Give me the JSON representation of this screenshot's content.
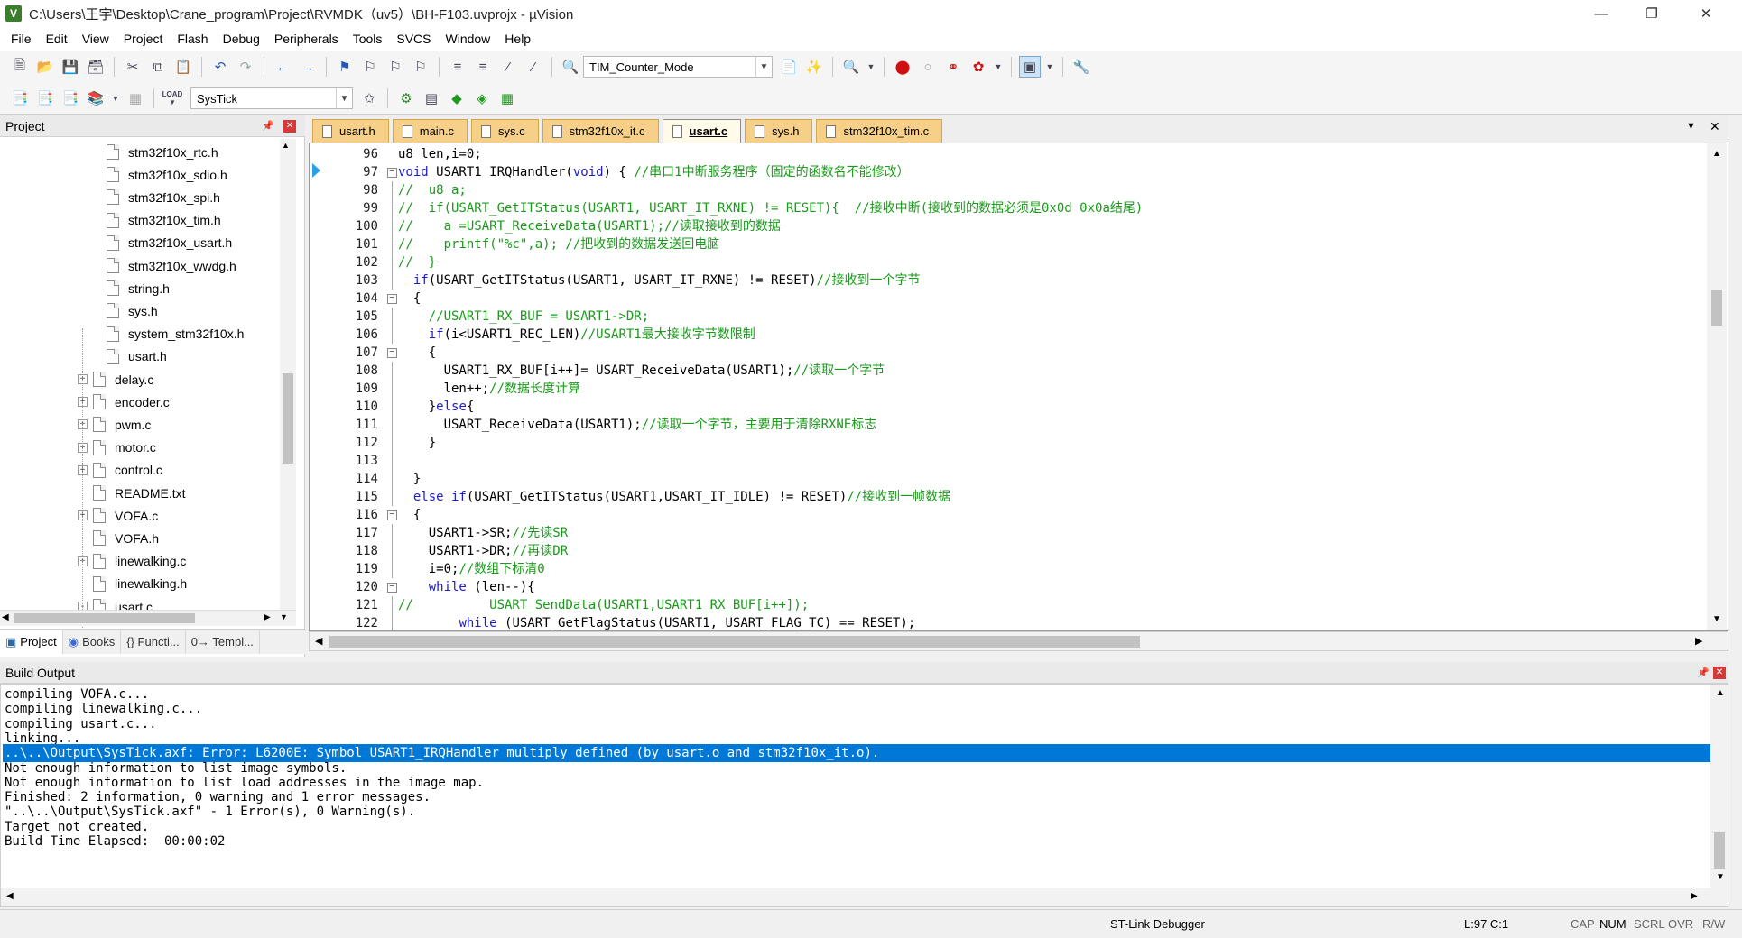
{
  "window": {
    "title": "C:\\Users\\王宇\\Desktop\\Crane_program\\Project\\RVMDK（uv5）\\BH-F103.uvprojx - µVision",
    "app_icon": "keil-icon"
  },
  "menu": [
    "File",
    "Edit",
    "View",
    "Project",
    "Flash",
    "Debug",
    "Peripherals",
    "Tools",
    "SVCS",
    "Window",
    "Help"
  ],
  "toolbar1": {
    "find_combo": "TIM_Counter_Mode"
  },
  "toolbar2": {
    "target_combo": "SysTick",
    "load_label": "LOAD"
  },
  "project_panel": {
    "title": "Project",
    "tree": [
      {
        "label": "stm32f10x_rtc.h",
        "level": 2,
        "expander": ""
      },
      {
        "label": "stm32f10x_sdio.h",
        "level": 2,
        "expander": ""
      },
      {
        "label": "stm32f10x_spi.h",
        "level": 2,
        "expander": ""
      },
      {
        "label": "stm32f10x_tim.h",
        "level": 2,
        "expander": ""
      },
      {
        "label": "stm32f10x_usart.h",
        "level": 2,
        "expander": ""
      },
      {
        "label": "stm32f10x_wwdg.h",
        "level": 2,
        "expander": ""
      },
      {
        "label": "string.h",
        "level": 2,
        "expander": ""
      },
      {
        "label": "sys.h",
        "level": 2,
        "expander": ""
      },
      {
        "label": "system_stm32f10x.h",
        "level": 2,
        "expander": ""
      },
      {
        "label": "usart.h",
        "level": 2,
        "expander": ""
      },
      {
        "label": "delay.c",
        "level": 1,
        "expander": "+"
      },
      {
        "label": "encoder.c",
        "level": 1,
        "expander": "+"
      },
      {
        "label": "pwm.c",
        "level": 1,
        "expander": "+"
      },
      {
        "label": "motor.c",
        "level": 1,
        "expander": "+"
      },
      {
        "label": "control.c",
        "level": 1,
        "expander": "+"
      },
      {
        "label": "README.txt",
        "level": 1,
        "expander": ""
      },
      {
        "label": "VOFA.c",
        "level": 1,
        "expander": "+"
      },
      {
        "label": "VOFA.h",
        "level": 1,
        "expander": ""
      },
      {
        "label": "linewalking.c",
        "level": 1,
        "expander": "+"
      },
      {
        "label": "linewalking.h",
        "level": 1,
        "expander": ""
      },
      {
        "label": "usart.c",
        "level": 1,
        "expander": "-"
      }
    ],
    "tabs": [
      "Project",
      "Books",
      "{} Functi...",
      "0→ Templ..."
    ]
  },
  "editor_tabs": [
    {
      "label": "usart.h",
      "active": false
    },
    {
      "label": "main.c",
      "active": false
    },
    {
      "label": "sys.c",
      "active": false
    },
    {
      "label": "stm32f10x_it.c",
      "active": false
    },
    {
      "label": "usart.c",
      "active": true
    },
    {
      "label": "sys.h",
      "active": false
    },
    {
      "label": "stm32f10x_tim.c",
      "active": false
    }
  ],
  "code_lines": [
    {
      "n": "96",
      "fold": "",
      "segs": [
        {
          "t": "u8 len,i=0;",
          "c": "blk"
        }
      ]
    },
    {
      "n": "97",
      "fold": "-",
      "segs": [
        {
          "t": "void",
          "c": "kw"
        },
        {
          "t": " USART1_IRQHandler(",
          "c": "blk"
        },
        {
          "t": "void",
          "c": "kw"
        },
        {
          "t": ") { ",
          "c": "blk"
        },
        {
          "t": "//串口1中断服务程序（固定的函数名不能修改）",
          "c": "cmt"
        }
      ]
    },
    {
      "n": "98",
      "fold": "|",
      "segs": [
        {
          "t": "//  u8 a;",
          "c": "cmt"
        }
      ]
    },
    {
      "n": "99",
      "fold": "|",
      "segs": [
        {
          "t": "//  if(USART_GetITStatus(USART1, USART_IT_RXNE) != RESET){  //接收中断(接收到的数据必须是0x0d 0x0a结尾)",
          "c": "cmt"
        }
      ]
    },
    {
      "n": "100",
      "fold": "|",
      "segs": [
        {
          "t": "//    a =USART_ReceiveData(USART1);//读取接收到的数据",
          "c": "cmt"
        }
      ]
    },
    {
      "n": "101",
      "fold": "|",
      "segs": [
        {
          "t": "//    printf(\"%c\",a); //把收到的数据发送回电脑",
          "c": "cmt"
        }
      ]
    },
    {
      "n": "102",
      "fold": "|",
      "segs": [
        {
          "t": "//  }",
          "c": "cmt"
        }
      ]
    },
    {
      "n": "103",
      "fold": "|",
      "segs": [
        {
          "t": "  ",
          "c": "blk"
        },
        {
          "t": "if",
          "c": "kw"
        },
        {
          "t": "(USART_GetITStatus(USART1, USART_IT_RXNE) != RESET)",
          "c": "blk"
        },
        {
          "t": "//接收到一个字节",
          "c": "cmt"
        }
      ]
    },
    {
      "n": "104",
      "fold": "-",
      "segs": [
        {
          "t": "  {",
          "c": "blk"
        }
      ]
    },
    {
      "n": "105",
      "fold": "|",
      "segs": [
        {
          "t": "    //USART1_RX_BUF = USART1->DR;",
          "c": "cmt"
        }
      ]
    },
    {
      "n": "106",
      "fold": "|",
      "segs": [
        {
          "t": "    ",
          "c": "blk"
        },
        {
          "t": "if",
          "c": "kw"
        },
        {
          "t": "(i<USART1_REC_LEN)",
          "c": "blk"
        },
        {
          "t": "//USART1最大接收字节数限制",
          "c": "cmt"
        }
      ]
    },
    {
      "n": "107",
      "fold": "-",
      "segs": [
        {
          "t": "    {",
          "c": "blk"
        }
      ]
    },
    {
      "n": "108",
      "fold": "|",
      "segs": [
        {
          "t": "      USART1_RX_BUF[i++]= USART_ReceiveData(USART1);",
          "c": "blk"
        },
        {
          "t": "//读取一个字节",
          "c": "cmt"
        }
      ]
    },
    {
      "n": "109",
      "fold": "|",
      "segs": [
        {
          "t": "      len++;",
          "c": "blk"
        },
        {
          "t": "//数据长度计算",
          "c": "cmt"
        }
      ]
    },
    {
      "n": "110",
      "fold": "|",
      "segs": [
        {
          "t": "    }",
          "c": "blk"
        },
        {
          "t": "else",
          "c": "kw"
        },
        {
          "t": "{",
          "c": "blk"
        }
      ]
    },
    {
      "n": "111",
      "fold": "|",
      "segs": [
        {
          "t": "      USART_ReceiveData(USART1);",
          "c": "blk"
        },
        {
          "t": "//读取一个字节，主要用于清除RXNE标志",
          "c": "cmt"
        }
      ]
    },
    {
      "n": "112",
      "fold": "|",
      "segs": [
        {
          "t": "    }",
          "c": "blk"
        }
      ]
    },
    {
      "n": "113",
      "fold": "-end",
      "segs": [
        {
          "t": "",
          "c": "blk"
        }
      ]
    },
    {
      "n": "114",
      "fold": "|",
      "segs": [
        {
          "t": "  }",
          "c": "blk"
        }
      ]
    },
    {
      "n": "115",
      "fold": "|",
      "segs": [
        {
          "t": "  ",
          "c": "blk"
        },
        {
          "t": "else if",
          "c": "kw"
        },
        {
          "t": "(USART_GetITStatus(USART1,USART_IT_IDLE) != RESET)",
          "c": "blk"
        },
        {
          "t": "//接收到一帧数据",
          "c": "cmt"
        }
      ]
    },
    {
      "n": "116",
      "fold": "-",
      "segs": [
        {
          "t": "  {",
          "c": "blk"
        }
      ]
    },
    {
      "n": "117",
      "fold": "|",
      "segs": [
        {
          "t": "    USART1->SR;",
          "c": "blk"
        },
        {
          "t": "//先读SR",
          "c": "cmt"
        }
      ]
    },
    {
      "n": "118",
      "fold": "|",
      "segs": [
        {
          "t": "    USART1->DR;",
          "c": "blk"
        },
        {
          "t": "//再读DR",
          "c": "cmt"
        }
      ]
    },
    {
      "n": "119",
      "fold": "|",
      "segs": [
        {
          "t": "    i=0;",
          "c": "blk"
        },
        {
          "t": "//数组下标清0",
          "c": "cmt"
        }
      ]
    },
    {
      "n": "120",
      "fold": "-",
      "segs": [
        {
          "t": "    ",
          "c": "blk"
        },
        {
          "t": "while",
          "c": "kw"
        },
        {
          "t": " (len--){",
          "c": "blk"
        }
      ]
    },
    {
      "n": "121",
      "fold": "|",
      "segs": [
        {
          "t": "//          USART_SendData(USART1,USART1_RX_BUF[i++]);",
          "c": "cmt"
        }
      ]
    },
    {
      "n": "122",
      "fold": "|",
      "segs": [
        {
          "t": "        ",
          "c": "blk"
        },
        {
          "t": "while",
          "c": "kw"
        },
        {
          "t": " (USART_GetFlagStatus(USART1, USART_FLAG_TC) == RESET);",
          "c": "blk"
        }
      ]
    }
  ],
  "build_output": {
    "title": "Build Output",
    "lines": [
      {
        "text": "compiling VOFA.c...",
        "highlight": false
      },
      {
        "text": "compiling linewalking.c...",
        "highlight": false
      },
      {
        "text": "compiling usart.c...",
        "highlight": false
      },
      {
        "text": "linking...",
        "highlight": false
      },
      {
        "text": "..\\..\\Output\\SysTick.axf: Error: L6200E: Symbol USART1_IRQHandler multiply defined (by usart.o and stm32f10x_it.o).",
        "highlight": true
      },
      {
        "text": "Not enough information to list image symbols.",
        "highlight": false
      },
      {
        "text": "Not enough information to list load addresses in the image map.",
        "highlight": false
      },
      {
        "text": "Finished: 2 information, 0 warning and 1 error messages.",
        "highlight": false
      },
      {
        "text": "\"..\\..\\Output\\SysTick.axf\" - 1 Error(s), 0 Warning(s).",
        "highlight": false
      },
      {
        "text": "Target not created.",
        "highlight": false
      },
      {
        "text": "Build Time Elapsed:  00:00:02",
        "highlight": false
      }
    ]
  },
  "status": {
    "debugger": "ST-Link Debugger",
    "position": "L:97 C:1",
    "cap": "CAP",
    "num": "NUM",
    "scrl": "SCRL",
    "ovr": "OVR",
    "rw": "R/W"
  }
}
